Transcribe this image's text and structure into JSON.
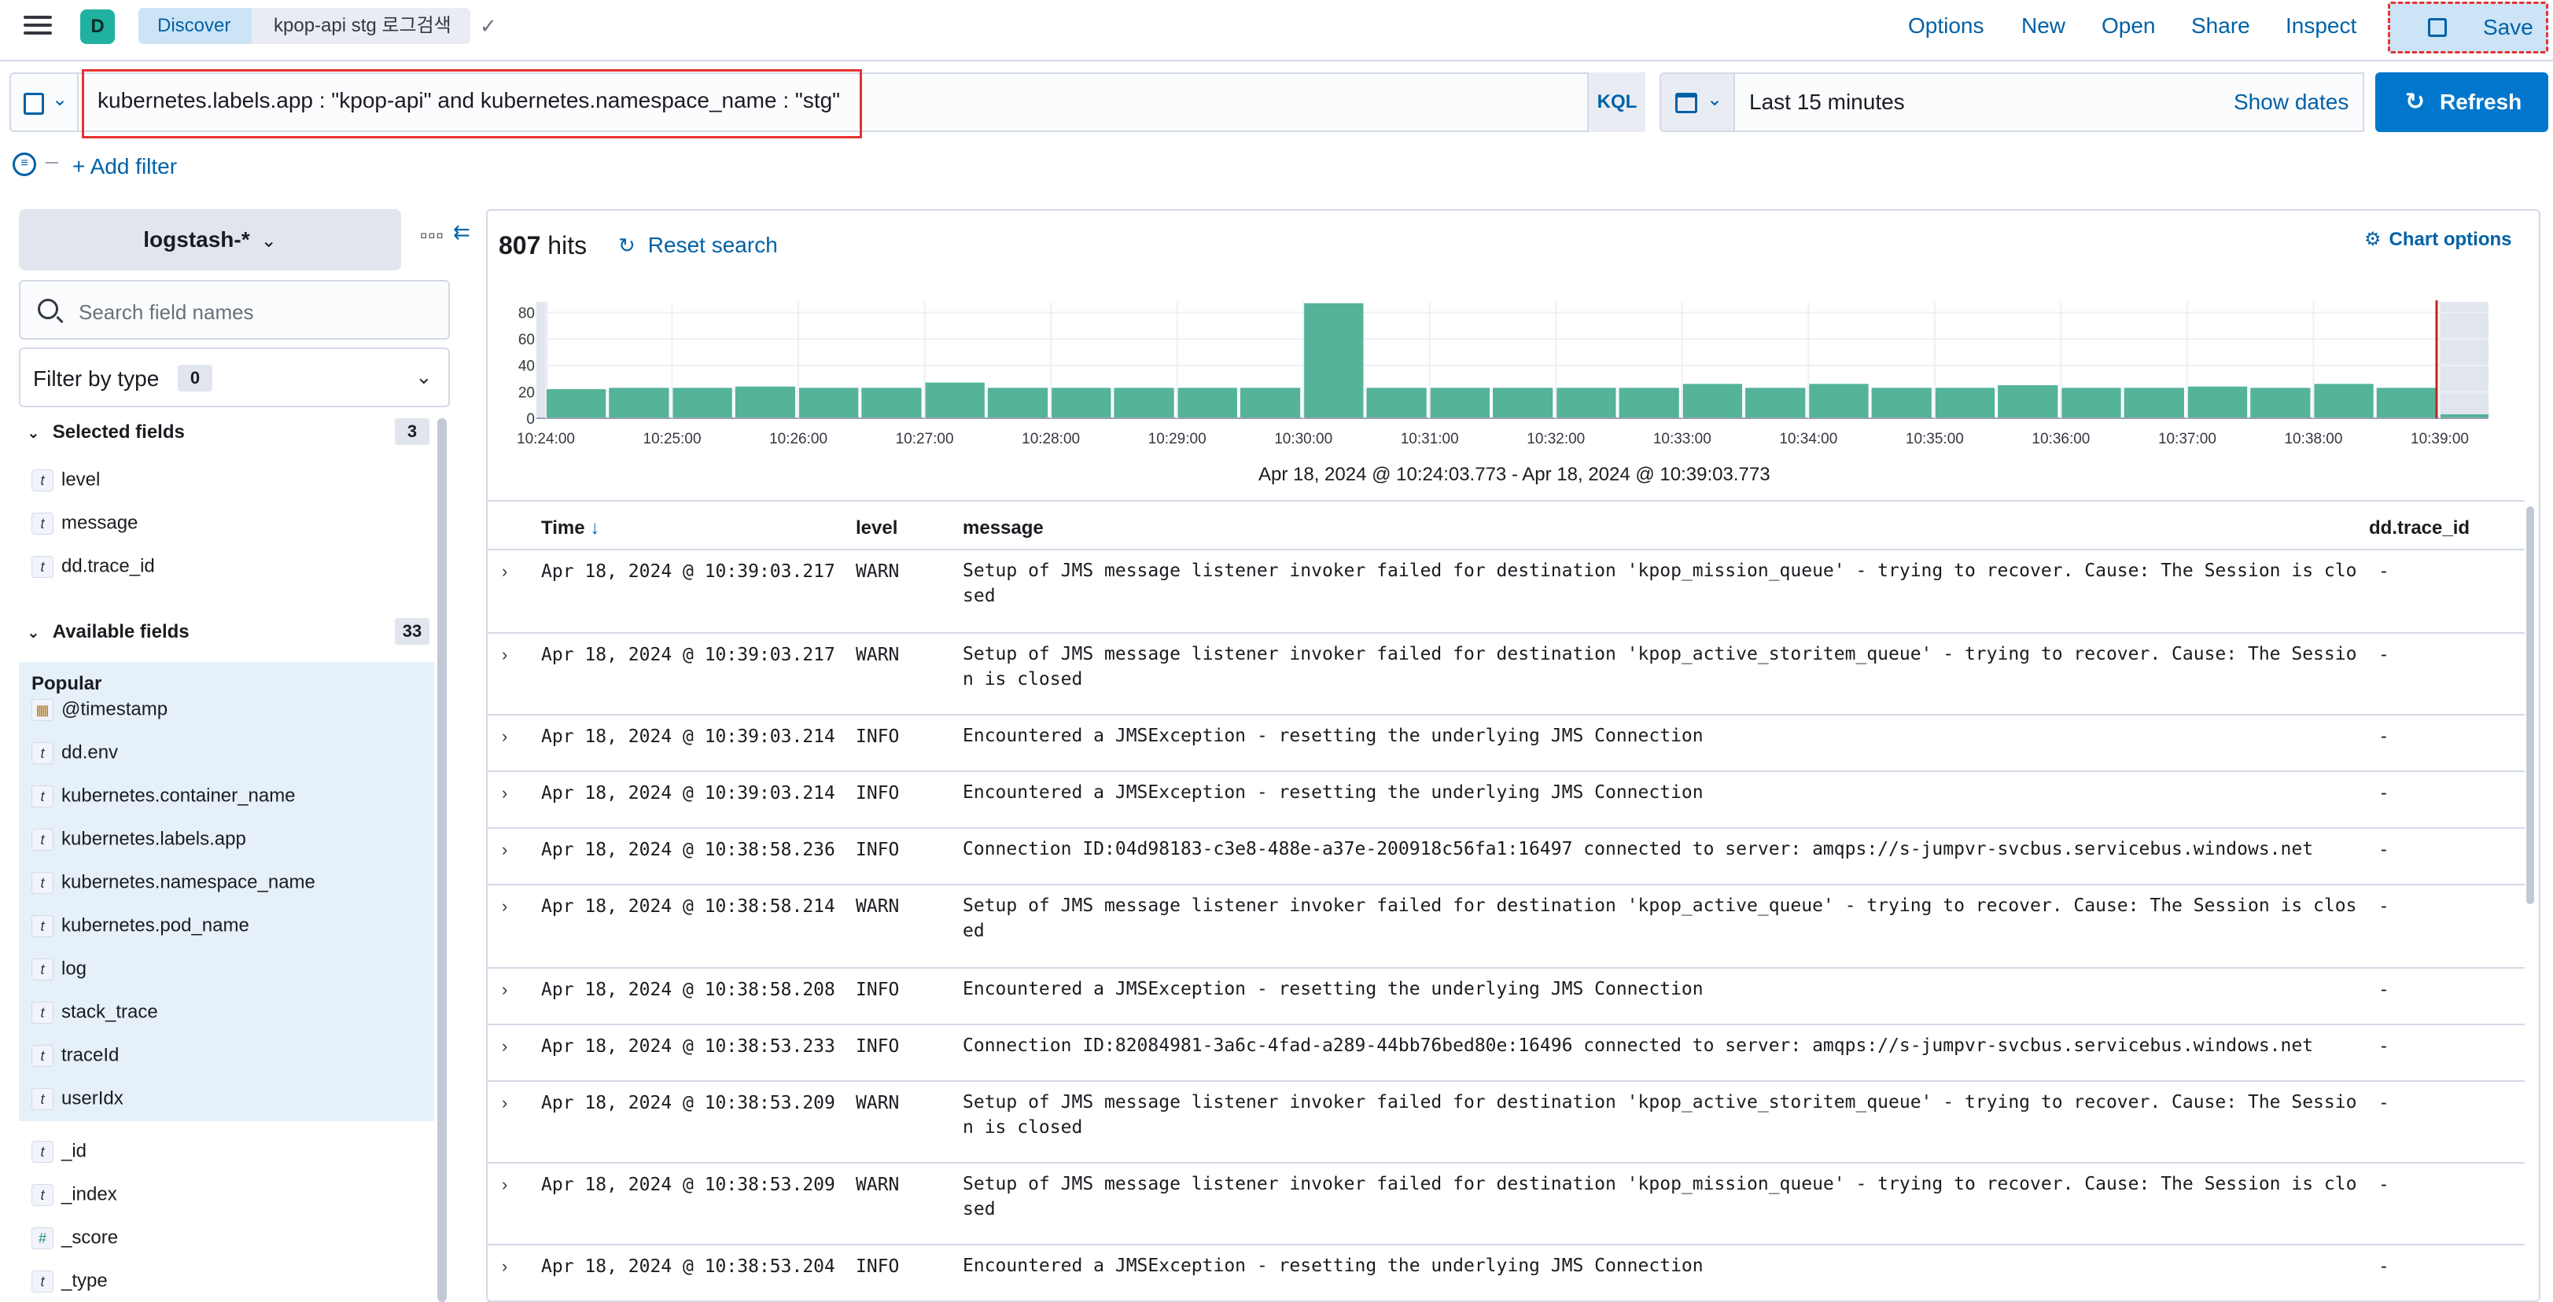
{
  "nav": {
    "space_letter": "D",
    "breadcrumb_app": "Discover",
    "breadcrumb_search": "kpop-api stg 로그검색",
    "menu": [
      "Options",
      "New",
      "Open",
      "Share",
      "Inspect"
    ],
    "save_label": "Save"
  },
  "query": {
    "text": "kubernetes.labels.app : \"kpop-api\" and kubernetes.namespace_name : \"stg\"",
    "language": "KQL",
    "time_range": "Last 15 minutes",
    "show_dates": "Show dates",
    "refresh_label": "Refresh",
    "add_filter": "+ Add filter"
  },
  "sidebar": {
    "index_pattern": "logstash-*",
    "search_placeholder": "Search field names",
    "filter_by_type": "Filter by type",
    "filter_count": "0",
    "selected_title": "Selected fields",
    "selected_count": "3",
    "selected_fields": [
      {
        "type": "t",
        "name": "level"
      },
      {
        "type": "t",
        "name": "message"
      },
      {
        "type": "t",
        "name": "dd.trace_id"
      }
    ],
    "available_title": "Available fields",
    "available_count": "33",
    "popular_label": "Popular",
    "popular_fields": [
      {
        "type": "cal",
        "name": "@timestamp"
      },
      {
        "type": "t",
        "name": "dd.env"
      },
      {
        "type": "t",
        "name": "kubernetes.container_name"
      },
      {
        "type": "t",
        "name": "kubernetes.labels.app"
      },
      {
        "type": "t",
        "name": "kubernetes.namespace_name"
      },
      {
        "type": "t",
        "name": "kubernetes.pod_name"
      },
      {
        "type": "t",
        "name": "log"
      },
      {
        "type": "t",
        "name": "stack_trace"
      },
      {
        "type": "t",
        "name": "traceId"
      },
      {
        "type": "t",
        "name": "userIdx"
      }
    ],
    "other_fields": [
      {
        "type": "t",
        "name": "_id"
      },
      {
        "type": "t",
        "name": "_index"
      },
      {
        "type": "#",
        "name": "_score"
      },
      {
        "type": "t",
        "name": "_type"
      }
    ]
  },
  "results": {
    "hits_count": "807",
    "hits_label": "hits",
    "reset_search": "Reset search",
    "chart_options": "Chart options",
    "range_label": "Apr 18, 2024 @ 10:24:03.773 - Apr 18, 2024 @ 10:39:03.773"
  },
  "chart_data": {
    "type": "bar",
    "x_ticks": [
      "10:24:00",
      "10:25:00",
      "10:26:00",
      "10:27:00",
      "10:28:00",
      "10:29:00",
      "10:30:00",
      "10:31:00",
      "10:32:00",
      "10:33:00",
      "10:34:00",
      "10:35:00",
      "10:36:00",
      "10:37:00",
      "10:38:00",
      "10:39:00"
    ],
    "y_ticks": [
      0,
      20,
      40,
      60,
      80
    ],
    "ylim": [
      0,
      88
    ],
    "values": [
      22,
      23,
      23,
      24,
      23,
      23,
      27,
      23,
      23,
      23,
      23,
      23,
      87,
      23,
      23,
      23,
      23,
      23,
      26,
      23,
      26,
      23,
      23,
      25,
      23,
      23,
      24,
      23,
      26,
      23,
      3
    ],
    "bar_color": "#54b399",
    "marker_color": "#bd271e"
  },
  "table": {
    "columns": [
      "Time",
      "level",
      "message",
      "dd.trace_id"
    ],
    "rows": [
      {
        "time": "Apr 18, 2024 @ 10:39:03.217",
        "level": "WARN",
        "message": "Setup of JMS message listener invoker failed for destination 'kpop_mission_queue' - trying to recover. Cause: The Session is closed",
        "trace": "-"
      },
      {
        "time": "Apr 18, 2024 @ 10:39:03.217",
        "level": "WARN",
        "message": "Setup of JMS message listener invoker failed for destination 'kpop_active_storitem_queue' - trying to recover. Cause: The Session is closed",
        "trace": "-"
      },
      {
        "time": "Apr 18, 2024 @ 10:39:03.214",
        "level": "INFO",
        "message": "Encountered a JMSException - resetting the underlying JMS Connection",
        "trace": "-"
      },
      {
        "time": "Apr 18, 2024 @ 10:39:03.214",
        "level": "INFO",
        "message": "Encountered a JMSException - resetting the underlying JMS Connection",
        "trace": "-"
      },
      {
        "time": "Apr 18, 2024 @ 10:38:58.236",
        "level": "INFO",
        "message": "Connection ID:04d98183-c3e8-488e-a37e-200918c56fa1:16497 connected to server: amqps://s-jumpvr-svcbus.servicebus.windows.net",
        "trace": "-"
      },
      {
        "time": "Apr 18, 2024 @ 10:38:58.214",
        "level": "WARN",
        "message": "Setup of JMS message listener invoker failed for destination 'kpop_active_queue' - trying to recover. Cause: The Session is closed",
        "trace": "-"
      },
      {
        "time": "Apr 18, 2024 @ 10:38:58.208",
        "level": "INFO",
        "message": "Encountered a JMSException - resetting the underlying JMS Connection",
        "trace": "-"
      },
      {
        "time": "Apr 18, 2024 @ 10:38:53.233",
        "level": "INFO",
        "message": "Connection ID:82084981-3a6c-4fad-a289-44bb76bed80e:16496 connected to server: amqps://s-jumpvr-svcbus.servicebus.windows.net",
        "trace": "-"
      },
      {
        "time": "Apr 18, 2024 @ 10:38:53.209",
        "level": "WARN",
        "message": "Setup of JMS message listener invoker failed for destination 'kpop_active_storitem_queue' - trying to recover. Cause: The Session is closed",
        "trace": "-"
      },
      {
        "time": "Apr 18, 2024 @ 10:38:53.209",
        "level": "WARN",
        "message": "Setup of JMS message listener invoker failed for destination 'kpop_mission_queue' - trying to recover. Cause: The Session is closed",
        "trace": "-"
      },
      {
        "time": "Apr 18, 2024 @ 10:38:53.204",
        "level": "INFO",
        "message": "Encountered a JMSException - resetting the underlying JMS Connection",
        "trace": "-"
      }
    ]
  }
}
